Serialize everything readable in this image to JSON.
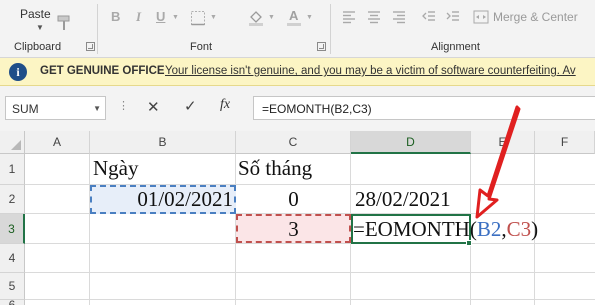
{
  "ribbon": {
    "clipboard": {
      "paste_label": "Paste",
      "group_label": "Clipboard"
    },
    "font": {
      "group_label": "Font",
      "bold": "B",
      "italic": "I",
      "underline": "U"
    },
    "alignment": {
      "group_label": "Alignment",
      "merge_label": "Merge & Center"
    }
  },
  "warning": {
    "title": "GET GENUINE OFFICE",
    "message": "Your license isn't genuine, and you may be a victim of software counterfeiting. Av"
  },
  "formula_bar": {
    "name_box": "SUM",
    "formula": "=EOMONTH(B2,C3)",
    "fx_label": "fx"
  },
  "columns": [
    "A",
    "B",
    "C",
    "D",
    "E",
    "F"
  ],
  "rows": [
    "1",
    "2",
    "3",
    "4",
    "5",
    "6"
  ],
  "cells": {
    "B1": "Ngày",
    "C1": "Số tháng",
    "B2": "01/02/2021",
    "C2": "0",
    "D2": "28/02/2021",
    "C3": "3",
    "D3_editing": {
      "prefix": "=EOMONTH(",
      "ref1": "B2",
      "comma": ",",
      "ref2": "C3",
      "suffix": ")"
    }
  },
  "colors": {
    "excel_green": "#217346",
    "ref1_blue": "#3b6fc2",
    "ref2_red": "#c0504d",
    "annotation_arrow": "#e02020"
  }
}
